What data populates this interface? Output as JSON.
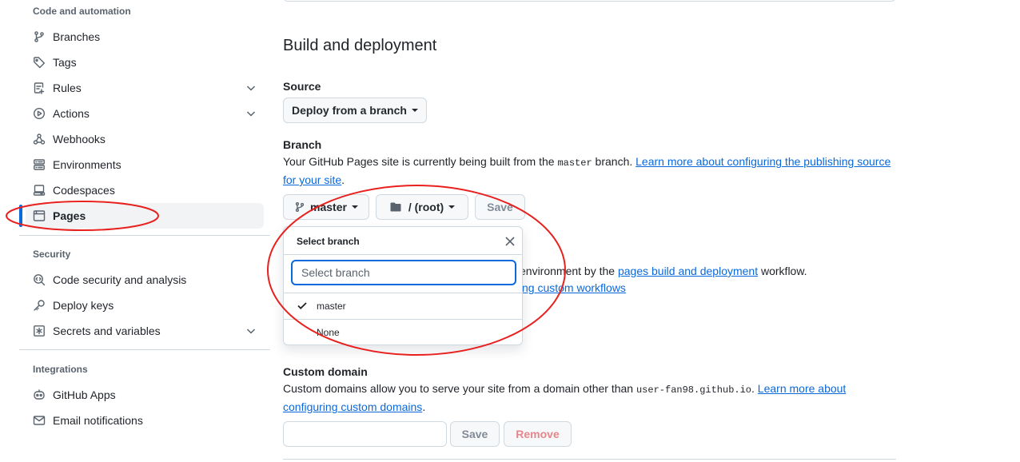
{
  "sidebar": {
    "sections": [
      {
        "heading": "Code and automation",
        "items": [
          {
            "label": "Branches",
            "icon": "branch-icon"
          },
          {
            "label": "Tags",
            "icon": "tag-icon"
          },
          {
            "label": "Rules",
            "icon": "rules-icon",
            "expandable": true
          },
          {
            "label": "Actions",
            "icon": "play-icon",
            "expandable": true
          },
          {
            "label": "Webhooks",
            "icon": "webhook-icon"
          },
          {
            "label": "Environments",
            "icon": "server-icon"
          },
          {
            "label": "Codespaces",
            "icon": "codespaces-icon"
          },
          {
            "label": "Pages",
            "icon": "browser-icon",
            "active": true
          }
        ]
      },
      {
        "heading": "Security",
        "items": [
          {
            "label": "Code security and analysis",
            "icon": "codescan-icon"
          },
          {
            "label": "Deploy keys",
            "icon": "key-icon"
          },
          {
            "label": "Secrets and variables",
            "icon": "asterisk-icon",
            "expandable": true
          }
        ]
      },
      {
        "heading": "Integrations",
        "items": [
          {
            "label": "GitHub Apps",
            "icon": "apps-icon"
          },
          {
            "label": "Email notifications",
            "icon": "mail-icon"
          }
        ]
      }
    ]
  },
  "main": {
    "build_heading": "Build and deployment",
    "source_label": "Source",
    "source_button": "Deploy from a branch",
    "branch_label": "Branch",
    "branch_text_1": "Your GitHub Pages site is currently being built from the ",
    "branch_text_code": "master",
    "branch_text_2": " branch. ",
    "branch_link": "Learn more about configuring the publishing source for your site",
    "branch_text_3": ".",
    "branch_button": "master",
    "folder_button": "/ (root)",
    "save_button": "Save",
    "workflow_text_1": "environment by the ",
    "workflow_link": "pages build and deployment",
    "workflow_text_2": " workflow.",
    "workflow_link_2": "ng custom workflows",
    "custom_domain_label": "Custom domain",
    "custom_text_1": "Custom domains allow you to serve your site from a domain other than ",
    "custom_text_code": "user-fan98.github.io",
    "custom_text_2": ". ",
    "custom_link": "Learn more about configuring custom domains",
    "custom_text_3": ".",
    "custom_input_value": "",
    "custom_save": "Save",
    "custom_remove": "Remove"
  },
  "dropdown": {
    "title": "Select branch",
    "search_placeholder": "Select branch",
    "options": [
      {
        "label": "master",
        "selected": true
      },
      {
        "label": "None",
        "selected": false
      }
    ]
  },
  "colors": {
    "accent": "#0969da",
    "annotation": "#e8201e"
  }
}
